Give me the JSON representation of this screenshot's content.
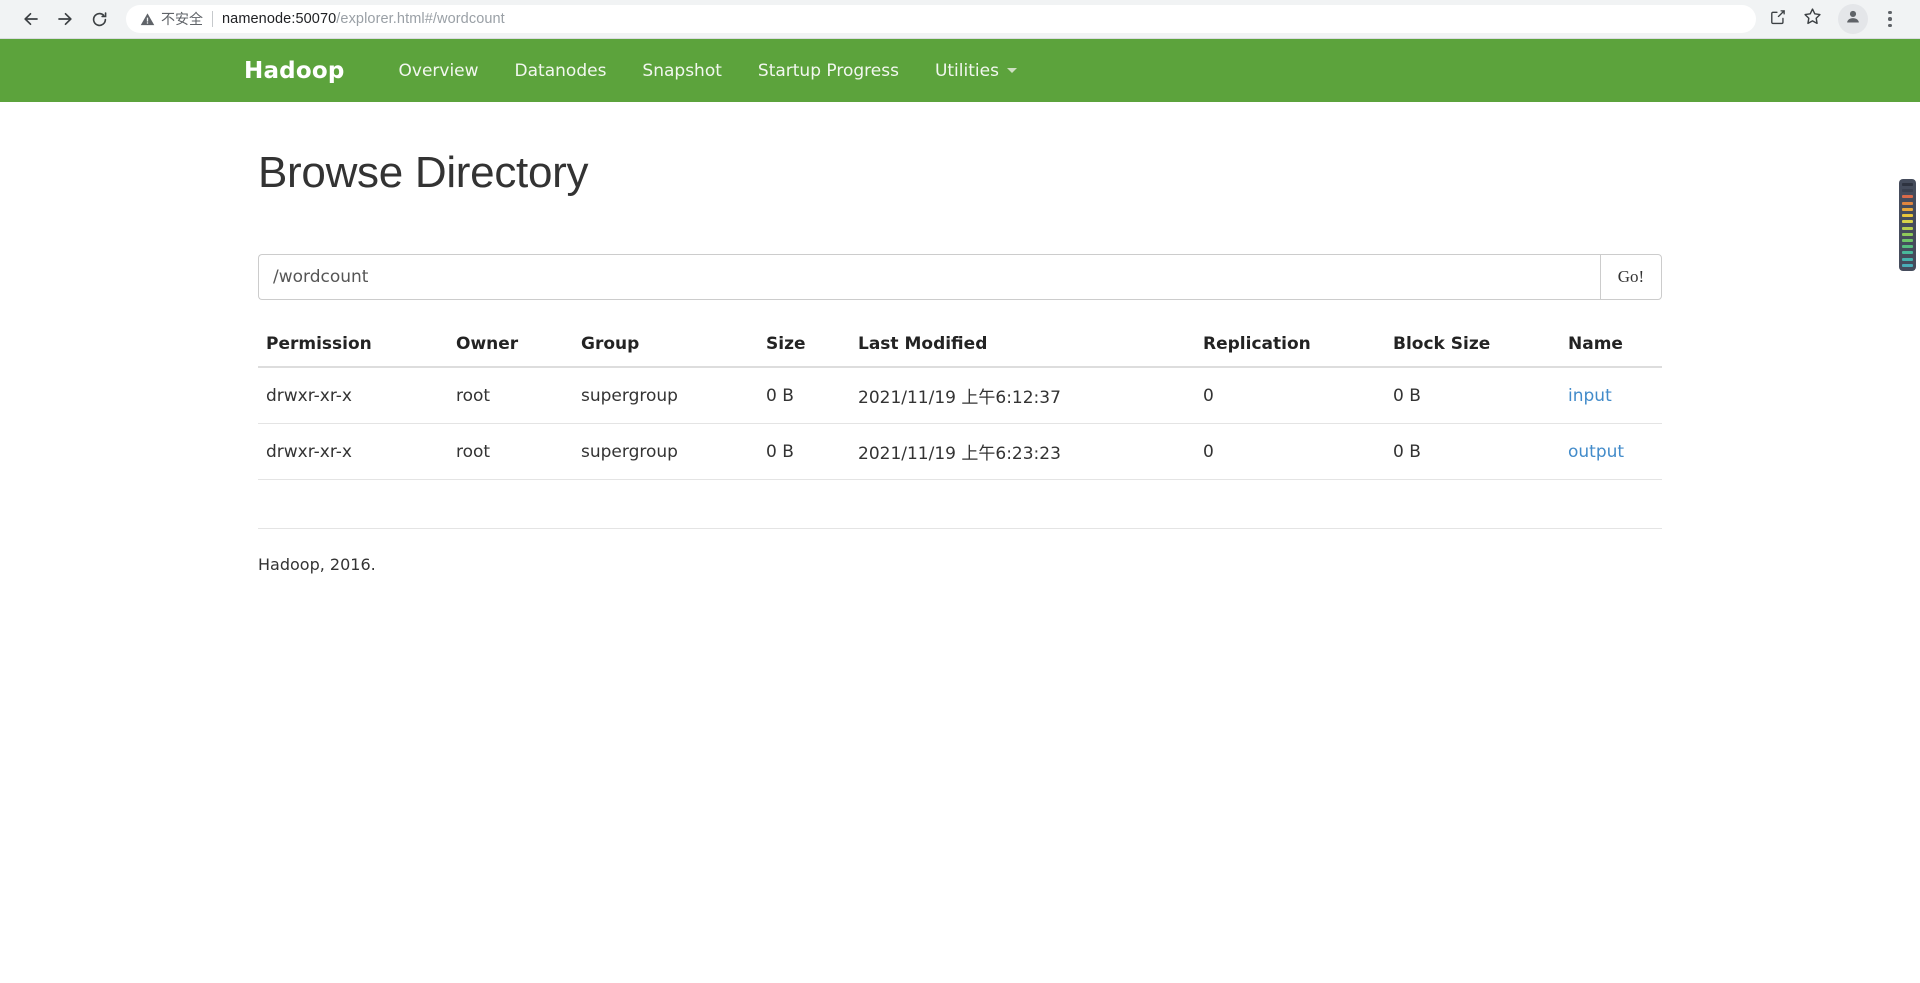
{
  "browser": {
    "back_icon": "back-arrow-icon",
    "forward_icon": "forward-arrow-icon",
    "reload_icon": "reload-icon",
    "security_label": "不安全",
    "url_host": "namenode:50070",
    "url_path": "/explorer.html#/wordcount",
    "url_full": "namenode:50070/explorer.html#/wordcount",
    "share_icon": "share-icon",
    "bookmark_icon": "star-icon",
    "profile_icon": "profile-avatar-icon",
    "menu_icon": "kebab-menu-icon"
  },
  "navbar": {
    "brand": "Hadoop",
    "links": [
      {
        "label": "Overview",
        "dropdown": false
      },
      {
        "label": "Datanodes",
        "dropdown": false
      },
      {
        "label": "Snapshot",
        "dropdown": false
      },
      {
        "label": "Startup Progress",
        "dropdown": false
      },
      {
        "label": "Utilities",
        "dropdown": true
      }
    ],
    "background_color": "#5CA33C",
    "text_color": "#f2f7ef"
  },
  "main": {
    "page_title": "Browse Directory",
    "path_input": {
      "value": "/wordcount",
      "placeholder": ""
    },
    "go_button": "Go!",
    "table": {
      "headers": [
        "Permission",
        "Owner",
        "Group",
        "Size",
        "Last Modified",
        "Replication",
        "Block Size",
        "Name"
      ],
      "rows": [
        {
          "permission": "drwxr-xr-x",
          "owner": "root",
          "group": "supergroup",
          "size": "0 B",
          "last_modified": "2021/11/19 上午6:12:37",
          "replication": "0",
          "block_size": "0 B",
          "name": "input"
        },
        {
          "permission": "drwxr-xr-x",
          "owner": "root",
          "group": "supergroup",
          "size": "0 B",
          "last_modified": "2021/11/19 上午6:23:23",
          "replication": "0",
          "block_size": "0 B",
          "name": "output"
        }
      ]
    },
    "link_color": "#428bca"
  },
  "footer": {
    "text": "Hadoop, 2016."
  },
  "scroll_marker": {
    "stripes": [
      "#2e3340",
      "#3a404f",
      "#d96a4a",
      "#e0863f",
      "#e8a93c",
      "#e8c63c",
      "#d7d24a",
      "#b6cf4e",
      "#8fca5a",
      "#6ec468",
      "#56bd80",
      "#49b89a",
      "#45b3ad",
      "#4aaeb8"
    ]
  }
}
